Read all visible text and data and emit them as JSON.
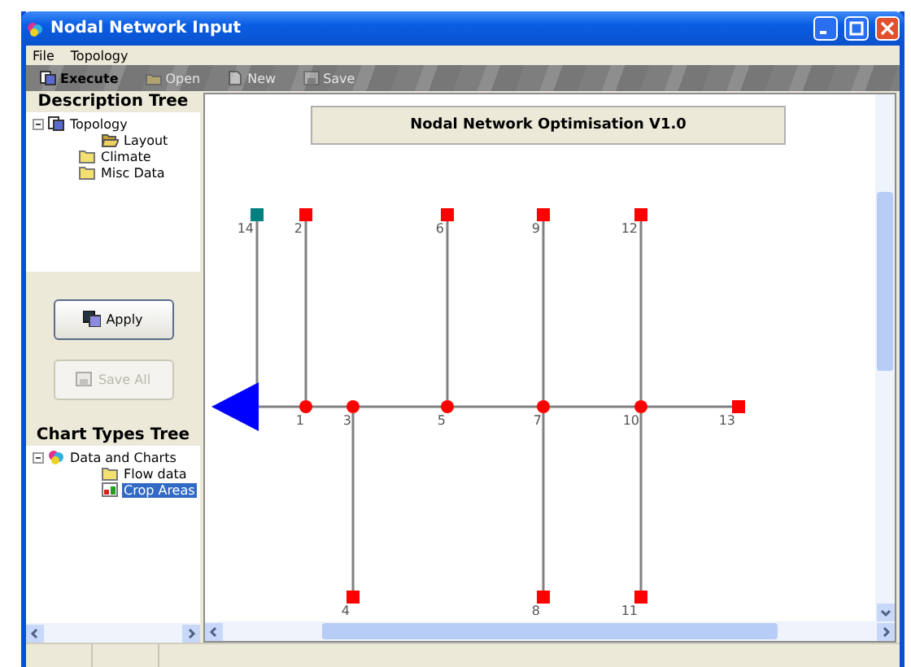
{
  "window": {
    "title": "Nodal Network Input"
  },
  "menu": [
    "File",
    "Topology"
  ],
  "toolbar": [
    {
      "label": "Execute",
      "kind": "execute",
      "disabled": false
    },
    {
      "label": "Open",
      "kind": "open",
      "disabled": true
    },
    {
      "label": "New",
      "kind": "new",
      "disabled": true
    },
    {
      "label": "Save",
      "kind": "save",
      "disabled": true
    }
  ],
  "description_tree": {
    "title": "Description Tree",
    "items": [
      {
        "label": "Topology",
        "kind": "pages",
        "expanded": true,
        "selected": false,
        "children": [
          {
            "label": "Layout",
            "kind": "open-folder",
            "selected": false
          }
        ]
      },
      {
        "label": "Climate",
        "kind": "folder",
        "selected": false
      },
      {
        "label": "Misc Data",
        "kind": "folder",
        "selected": false
      }
    ]
  },
  "buttons": [
    {
      "label": "Apply",
      "kind": "apply",
      "disabled": false
    },
    {
      "label": "Save All",
      "kind": "save",
      "disabled": true
    }
  ],
  "chart_types_tree": {
    "title": "Chart Types Tree",
    "items": [
      {
        "label": "Data and Charts",
        "kind": "chart-group",
        "expanded": true,
        "selected": false,
        "children": [
          {
            "label": "Flow data",
            "kind": "folder",
            "selected": false
          },
          {
            "label": "Crop Areas",
            "kind": "chart",
            "selected": true
          }
        ]
      }
    ]
  },
  "canvas": {
    "banner": "Nodal Network Optimisation V1.0",
    "network": {
      "feeder": {
        "label": "14",
        "color": "#008080"
      },
      "junctions": [
        {
          "label": "1",
          "up": {
            "label": "2",
            "color": "#ff0000"
          }
        },
        {
          "label": "3",
          "down": {
            "label": "4",
            "color": "#ff0000"
          }
        },
        {
          "label": "5",
          "up": {
            "label": "6",
            "color": "#ff0000"
          }
        },
        {
          "label": "7",
          "up": {
            "label": "9",
            "color": "#ff0000"
          },
          "down": {
            "label": "8",
            "color": "#ff0000"
          }
        },
        {
          "label": "10",
          "up": {
            "label": "12",
            "color": "#ff0000"
          },
          "down": {
            "label": "11",
            "color": "#ff0000"
          }
        }
      ],
      "end": {
        "label": "13",
        "color": "#ff0000"
      }
    }
  }
}
